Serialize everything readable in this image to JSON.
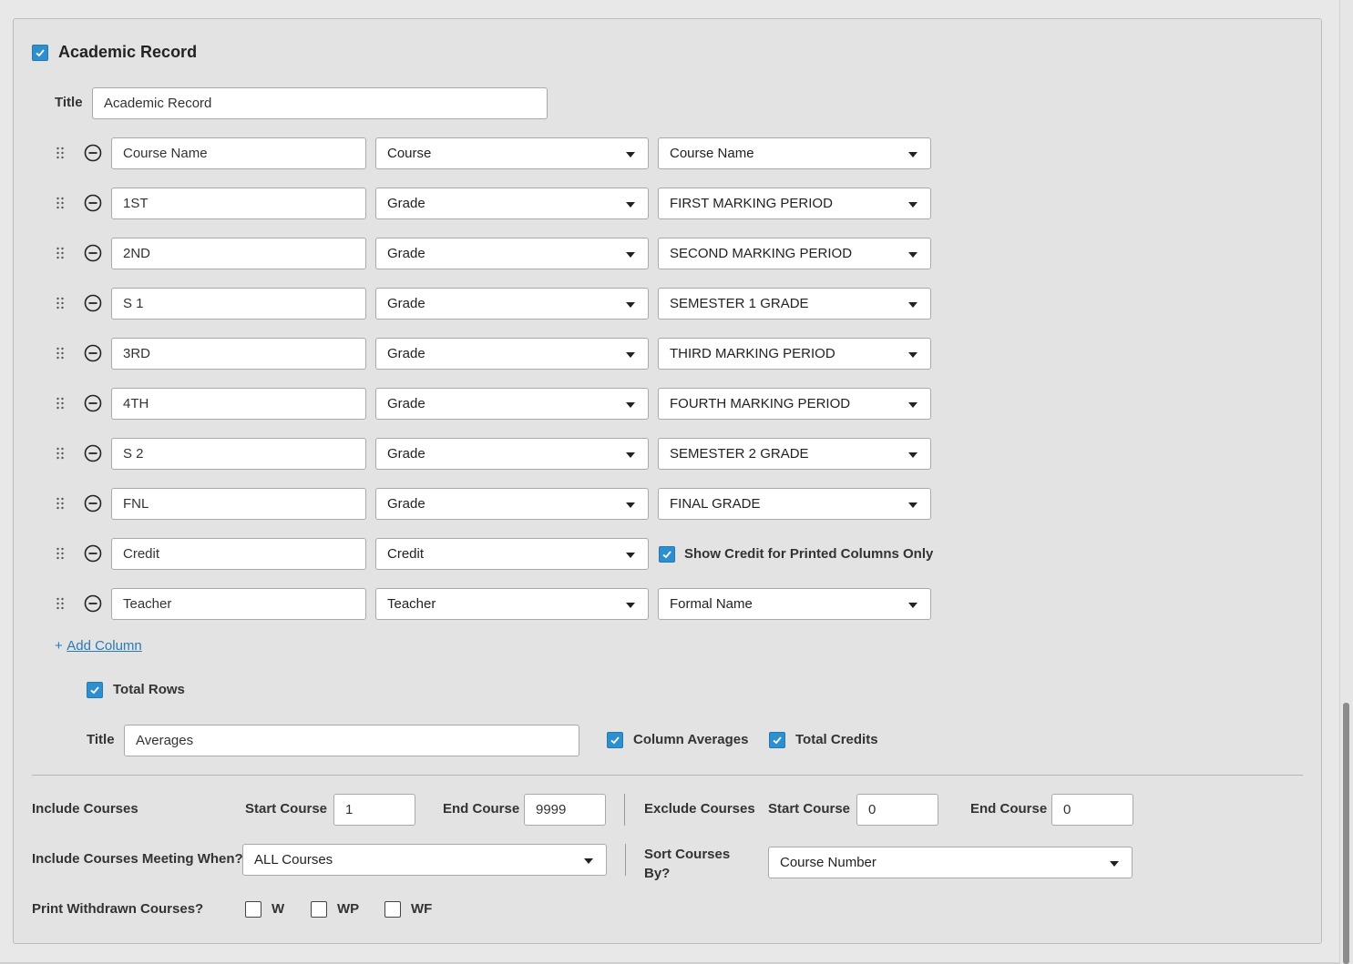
{
  "section": {
    "header_label": "Academic Record",
    "header_checked": true,
    "title_label": "Title",
    "title_value": "Academic Record"
  },
  "columns": [
    {
      "name": "Course Name",
      "type": "Course",
      "field": "Course Name"
    },
    {
      "name": "1ST",
      "type": "Grade",
      "field": "FIRST MARKING PERIOD"
    },
    {
      "name": "2ND",
      "type": "Grade",
      "field": "SECOND MARKING PERIOD"
    },
    {
      "name": "S 1",
      "type": "Grade",
      "field": "SEMESTER 1 GRADE"
    },
    {
      "name": "3RD",
      "type": "Grade",
      "field": "THIRD MARKING PERIOD"
    },
    {
      "name": "4TH",
      "type": "Grade",
      "field": "FOURTH MARKING PERIOD"
    },
    {
      "name": "S 2",
      "type": "Grade",
      "field": "SEMESTER 2 GRADE"
    },
    {
      "name": "FNL",
      "type": "Grade",
      "field": "FINAL GRADE"
    },
    {
      "name": "Credit",
      "type": "Credit",
      "field": null,
      "checkbox_label": "Show Credit for Printed Columns Only",
      "checkbox_checked": true
    },
    {
      "name": "Teacher",
      "type": "Teacher",
      "field": "Formal Name"
    }
  ],
  "add_column": {
    "plus": "+",
    "label": "Add Column"
  },
  "totals": {
    "total_rows_label": "Total Rows",
    "total_rows_checked": true,
    "title_label": "Title",
    "title_value": "Averages",
    "column_averages_label": "Column Averages",
    "column_averages_checked": true,
    "total_credits_label": "Total Credits",
    "total_credits_checked": true
  },
  "include": {
    "label": "Include Courses",
    "start_label": "Start Course",
    "start_value": "1",
    "end_label": "End Course",
    "end_value": "9999"
  },
  "exclude": {
    "label": "Exclude Courses",
    "start_label": "Start Course",
    "start_value": "0",
    "end_label": "End Course",
    "end_value": "0"
  },
  "meeting": {
    "label": "Include Courses Meeting When?",
    "value": "ALL Courses"
  },
  "sort": {
    "label_line1": "Sort Courses",
    "label_line2": "By?",
    "value": "Course Number"
  },
  "withdrawn": {
    "label": "Print Withdrawn Courses?",
    "options": [
      {
        "label": "W",
        "checked": false
      },
      {
        "label": "WP",
        "checked": false
      },
      {
        "label": "WF",
        "checked": false
      }
    ]
  },
  "colors": {
    "accent": "#2e8fce",
    "link": "#2a7ab8"
  }
}
